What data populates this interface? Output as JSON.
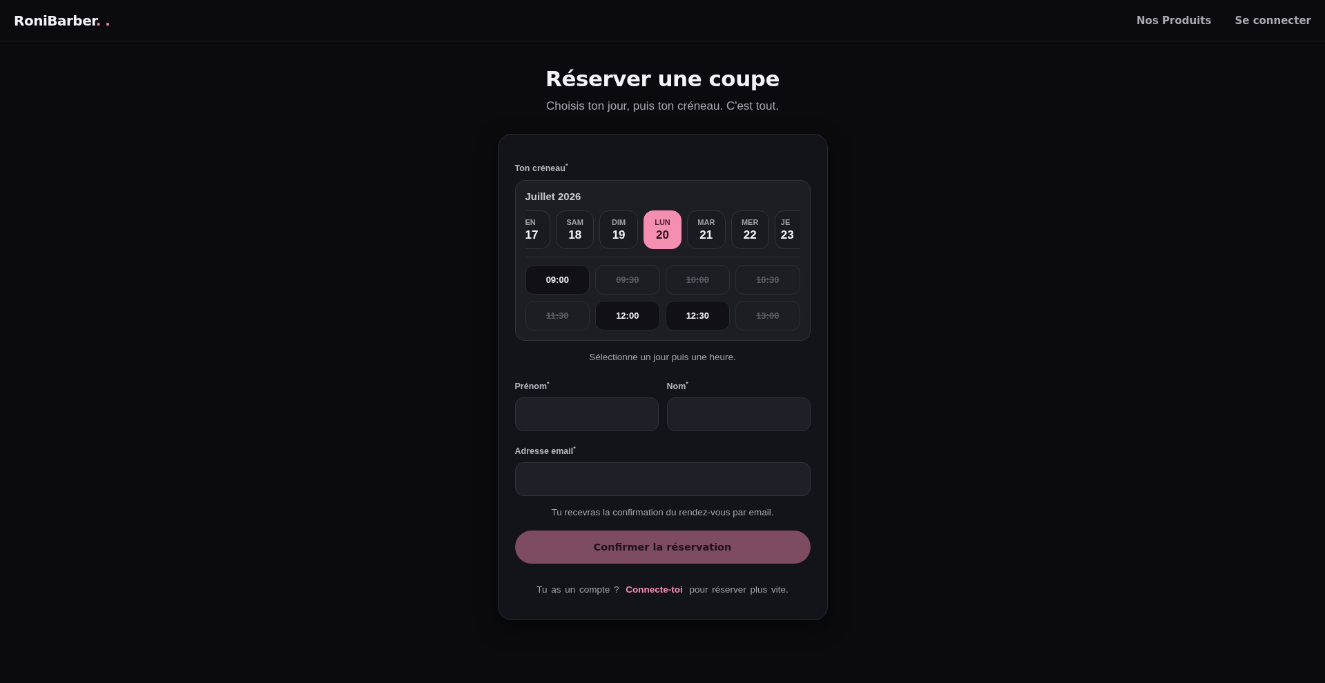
{
  "header": {
    "logo": "RoniBarber",
    "logo_accent": ". .",
    "nav": [
      {
        "label": "Nos Produits"
      },
      {
        "label": "Se connecter"
      }
    ]
  },
  "page": {
    "title": "Réserver une coupe",
    "subtitle": "Choisis ton jour, puis ton créneau. C'est tout."
  },
  "booking": {
    "slot_label": "Ton créneau$^{*}$",
    "month": "Juillet 2026",
    "days": [
      {
        "kind": "cut-left",
        "weekday": "EN",
        "date": "17",
        "selected": false
      },
      {
        "kind": "full",
        "weekday": "SAM",
        "date": "18",
        "selected": false
      },
      {
        "kind": "full",
        "weekday": "DIM",
        "date": "19",
        "selected": false
      },
      {
        "kind": "full",
        "weekday": "LUN",
        "date": "20",
        "selected": true
      },
      {
        "kind": "full",
        "weekday": "MAR",
        "date": "21",
        "selected": false
      },
      {
        "kind": "full",
        "weekday": "MER",
        "date": "22",
        "selected": false
      },
      {
        "kind": "cut-right",
        "weekday": "JE",
        "date": "23",
        "selected": false
      }
    ],
    "slots": [
      {
        "time": "09:00",
        "available": true
      },
      {
        "time": "09:30",
        "available": false
      },
      {
        "time": "10:00",
        "available": false
      },
      {
        "time": "10:30",
        "available": false
      },
      {
        "time": "11:30",
        "available": false
      },
      {
        "time": "12:00",
        "available": true
      },
      {
        "time": "12:30",
        "available": true
      },
      {
        "time": "13:00",
        "available": false
      }
    ],
    "hint": "Sélectionne un jour puis une heure.",
    "fields": [
      {
        "label": "Prénom$^{*}$",
        "kind": "half"
      },
      {
        "label": "Nom$^{*}$",
        "kind": "half"
      },
      {
        "label": "Adresse email$^{*}$",
        "kind": "full"
      }
    ],
    "note": "Tu recevras la confirmation du rendez-vous par email.",
    "submit": {
      "label": "Confirmer la réservation",
      "disabled": true
    },
    "login_prompt": {
      "before": "Tu as un compte ?",
      "link": "Connecte-toi",
      "after": "pour réserver plus vite."
    }
  }
}
